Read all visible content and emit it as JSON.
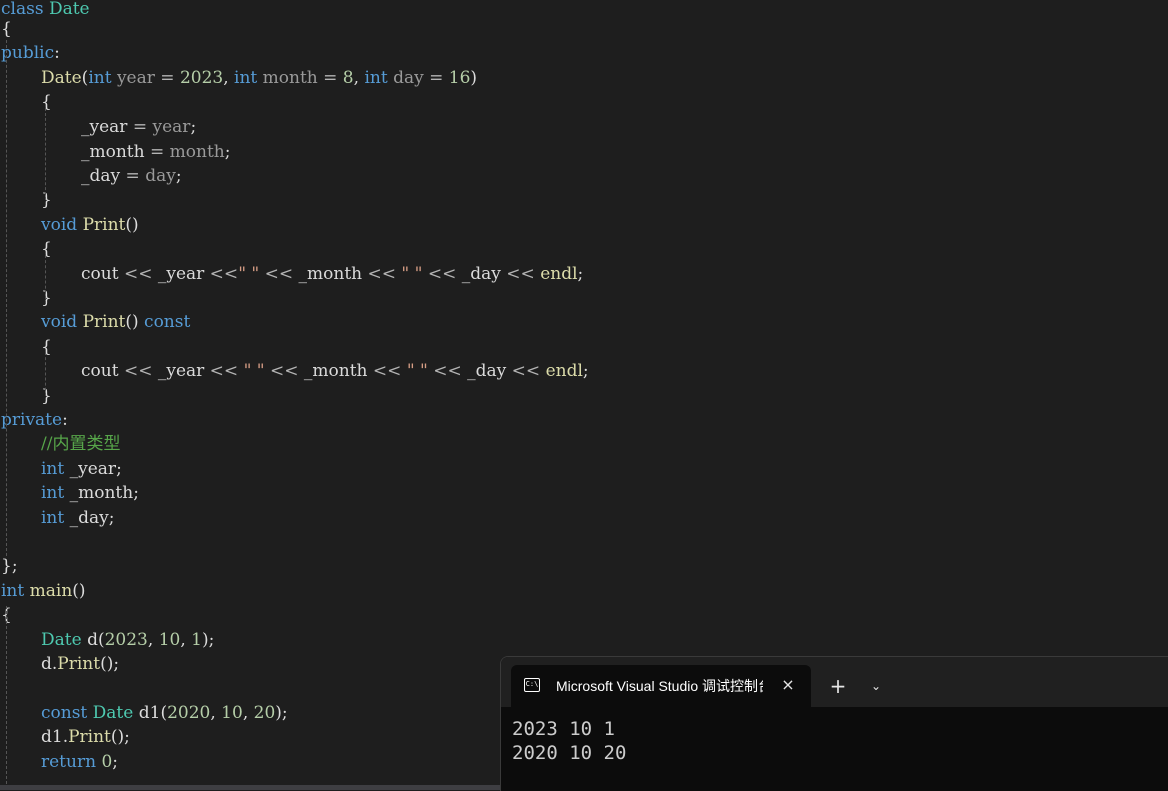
{
  "code": {
    "l1": [
      "class",
      " ",
      "Date"
    ],
    "l2": [
      "{"
    ],
    "l3": [
      "public",
      ":"
    ],
    "l4": [
      "Date",
      "(",
      "int",
      " ",
      "year",
      " = ",
      "2023",
      ", ",
      "int",
      " ",
      "month",
      " = ",
      "8",
      ", ",
      "int",
      " ",
      "day",
      " = ",
      "16",
      ")"
    ],
    "l5": [
      "{"
    ],
    "l6": [
      "_year",
      " = ",
      "year",
      ";"
    ],
    "l7": [
      "_month",
      " = ",
      "month",
      ";"
    ],
    "l8": [
      "_day",
      " = ",
      "day",
      ";"
    ],
    "l9": [
      "}"
    ],
    "l10": [
      "void",
      " ",
      "Print",
      "()"
    ],
    "l11": [
      "{"
    ],
    "l12": [
      "cout",
      " << ",
      "_year",
      " <<",
      "\" \"",
      " << ",
      "_month",
      " << ",
      "\" \"",
      " << ",
      "_day",
      " << ",
      "endl",
      ";"
    ],
    "l13": [
      "}"
    ],
    "l14": [
      "void",
      " ",
      "Print",
      "() ",
      "const"
    ],
    "l15": [
      "{"
    ],
    "l16": [
      "cout",
      " << ",
      "_year",
      " << ",
      "\" \"",
      " << ",
      "_month",
      " << ",
      "\" \"",
      " << ",
      "_day",
      " << ",
      "endl",
      ";"
    ],
    "l17": [
      "}"
    ],
    "l18": [
      "private",
      ":"
    ],
    "l19": [
      "//内置类型"
    ],
    "l20": [
      "int",
      " ",
      "_year",
      ";"
    ],
    "l21": [
      "int",
      " ",
      "_month",
      ";"
    ],
    "l22": [
      "int",
      " ",
      "_day",
      ";"
    ],
    "l23": [
      "};"
    ],
    "l24": [
      "int",
      " ",
      "main",
      "()"
    ],
    "l25": [
      "{"
    ],
    "l26": [
      "Date",
      " ",
      "d",
      "(",
      "2023",
      ", ",
      "10",
      ", ",
      "1",
      ");"
    ],
    "l27": [
      "d",
      ".",
      "Print",
      "();"
    ],
    "l28": [
      "const",
      " ",
      "Date",
      " ",
      "d1",
      "(",
      "2020",
      ", ",
      "10",
      ", ",
      "20",
      ");"
    ],
    "l29": [
      "d1",
      ".",
      "Print",
      "();"
    ],
    "l30": [
      "return",
      " ",
      "0",
      ";"
    ]
  },
  "console": {
    "tab_title": "Microsoft Visual Studio 调试控制台",
    "tab_icon_label": "C:\\",
    "close_icon": "×",
    "new_tab_icon": "+",
    "dropdown_icon": "⌄",
    "output": [
      "2023 10 1",
      "2020 10 20"
    ]
  },
  "colors": {
    "editor_bg": "#1e1e1e",
    "keyword": "#569cd6",
    "type": "#4ec9b0",
    "function": "#dcdcaa",
    "number": "#b5cea8",
    "string": "#d69d85",
    "parameter": "#9a9a9a",
    "comment": "#57a64a",
    "console_bg": "#0c0c0c"
  }
}
